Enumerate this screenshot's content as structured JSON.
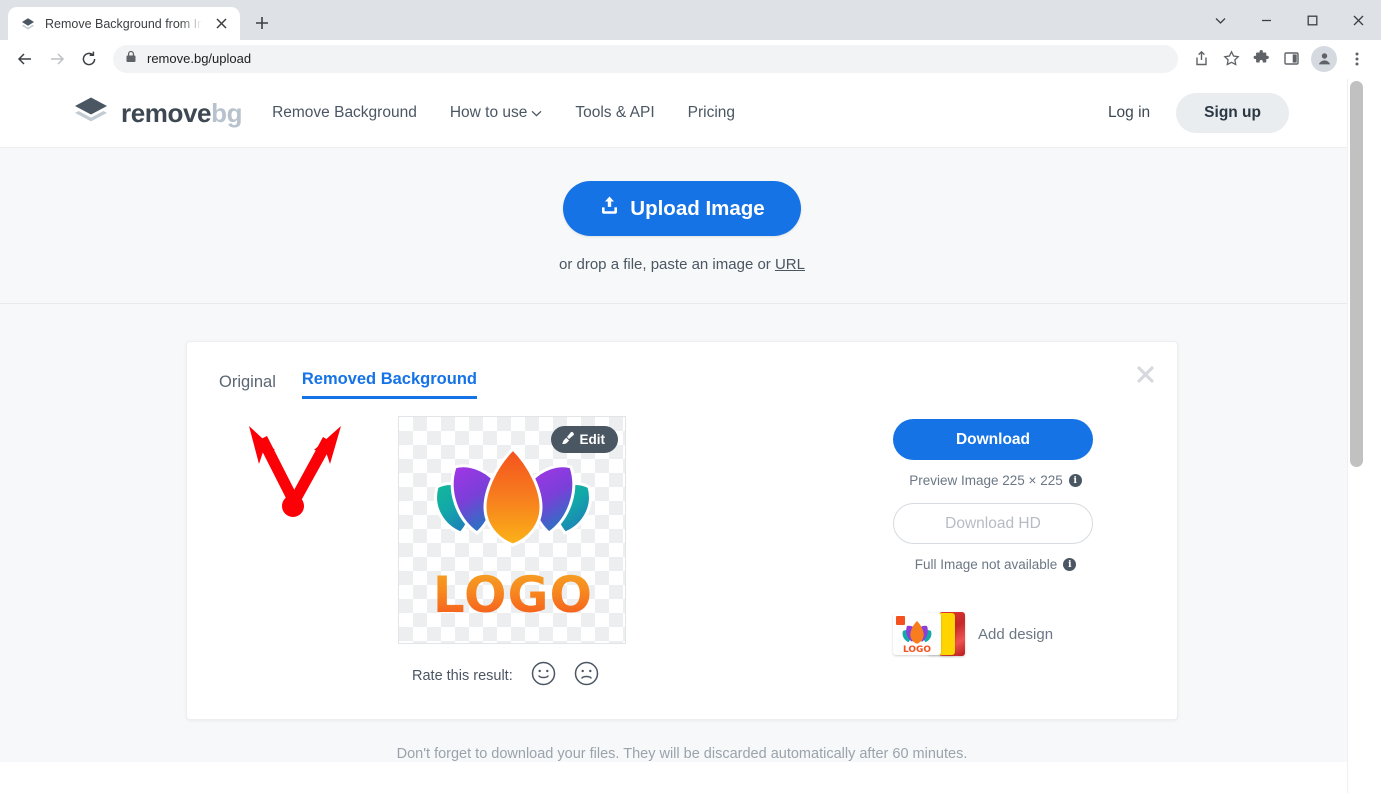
{
  "browser": {
    "tab": {
      "title": "Remove Background from Image",
      "favicon_icon": "layers-diamond-icon",
      "close_icon": "close-icon"
    },
    "new_tab_icon": "plus-icon",
    "window_controls": {
      "expand_icon": "chevron-down-icon",
      "minimize_icon": "minimize-icon",
      "maximize_icon": "maximize-icon",
      "close_icon": "close-icon"
    },
    "toolbar": {
      "back_icon": "arrow-left-icon",
      "forward_icon": "arrow-right-icon",
      "reload_icon": "reload-icon",
      "lock_icon": "lock-icon",
      "url": "remove.bg/upload",
      "share_icon": "share-icon",
      "bookmark_icon": "star-icon",
      "extensions_icon": "puzzle-icon",
      "sidepanel_icon": "sidepanel-icon",
      "profile_icon": "avatar-icon",
      "menu_icon": "three-dot-menu-icon"
    }
  },
  "site_header": {
    "logo": {
      "icon": "layers-diamond-icon",
      "text_primary": "remove",
      "text_secondary": "bg"
    },
    "nav": [
      {
        "label": "Remove Background",
        "has_caret": false
      },
      {
        "label": "How to use",
        "has_caret": true
      },
      {
        "label": "Tools & API",
        "has_caret": false
      },
      {
        "label": "Pricing",
        "has_caret": false
      }
    ],
    "login_label": "Log in",
    "signup_label": "Sign up"
  },
  "upload": {
    "button_label": "Upload Image",
    "button_icon": "upload-icon",
    "hint_prefix": "or drop a file, paste an image or ",
    "hint_link": "URL"
  },
  "result_card": {
    "close_icon": "close-icon",
    "tabs": [
      {
        "label": "Original",
        "active": false
      },
      {
        "label": "Removed Background",
        "active": true
      }
    ],
    "annotation": {
      "icon": "red-double-arrow-annotation"
    },
    "preview": {
      "edit_label": "Edit",
      "edit_icon": "brush-icon",
      "artwork_alt": "lotus-logo",
      "artwork_word": "LOGO"
    },
    "rate": {
      "label": "Rate this result:",
      "happy_icon": "smiley-happy-icon",
      "sad_icon": "smiley-sad-icon"
    },
    "actions": {
      "download_label": "Download",
      "preview_note": "Preview Image 225 × 225",
      "preview_note_info_icon": "info-icon",
      "download_hd_label": "Download HD",
      "hd_note": "Full Image not available",
      "hd_note_info_icon": "info-icon",
      "add_design_label": "Add design",
      "add_design_icon": "design-thumbnails-icon"
    }
  },
  "footer_note": "Don't forget to download your files. They will be discarded automatically after 60 minutes.",
  "colors": {
    "accent_blue": "#1573e6",
    "page_bg": "#f7f8f9",
    "annotation_red": "#fb0007",
    "logo_dark": "#3d4852",
    "logo_grey": "#b8c2cc"
  }
}
